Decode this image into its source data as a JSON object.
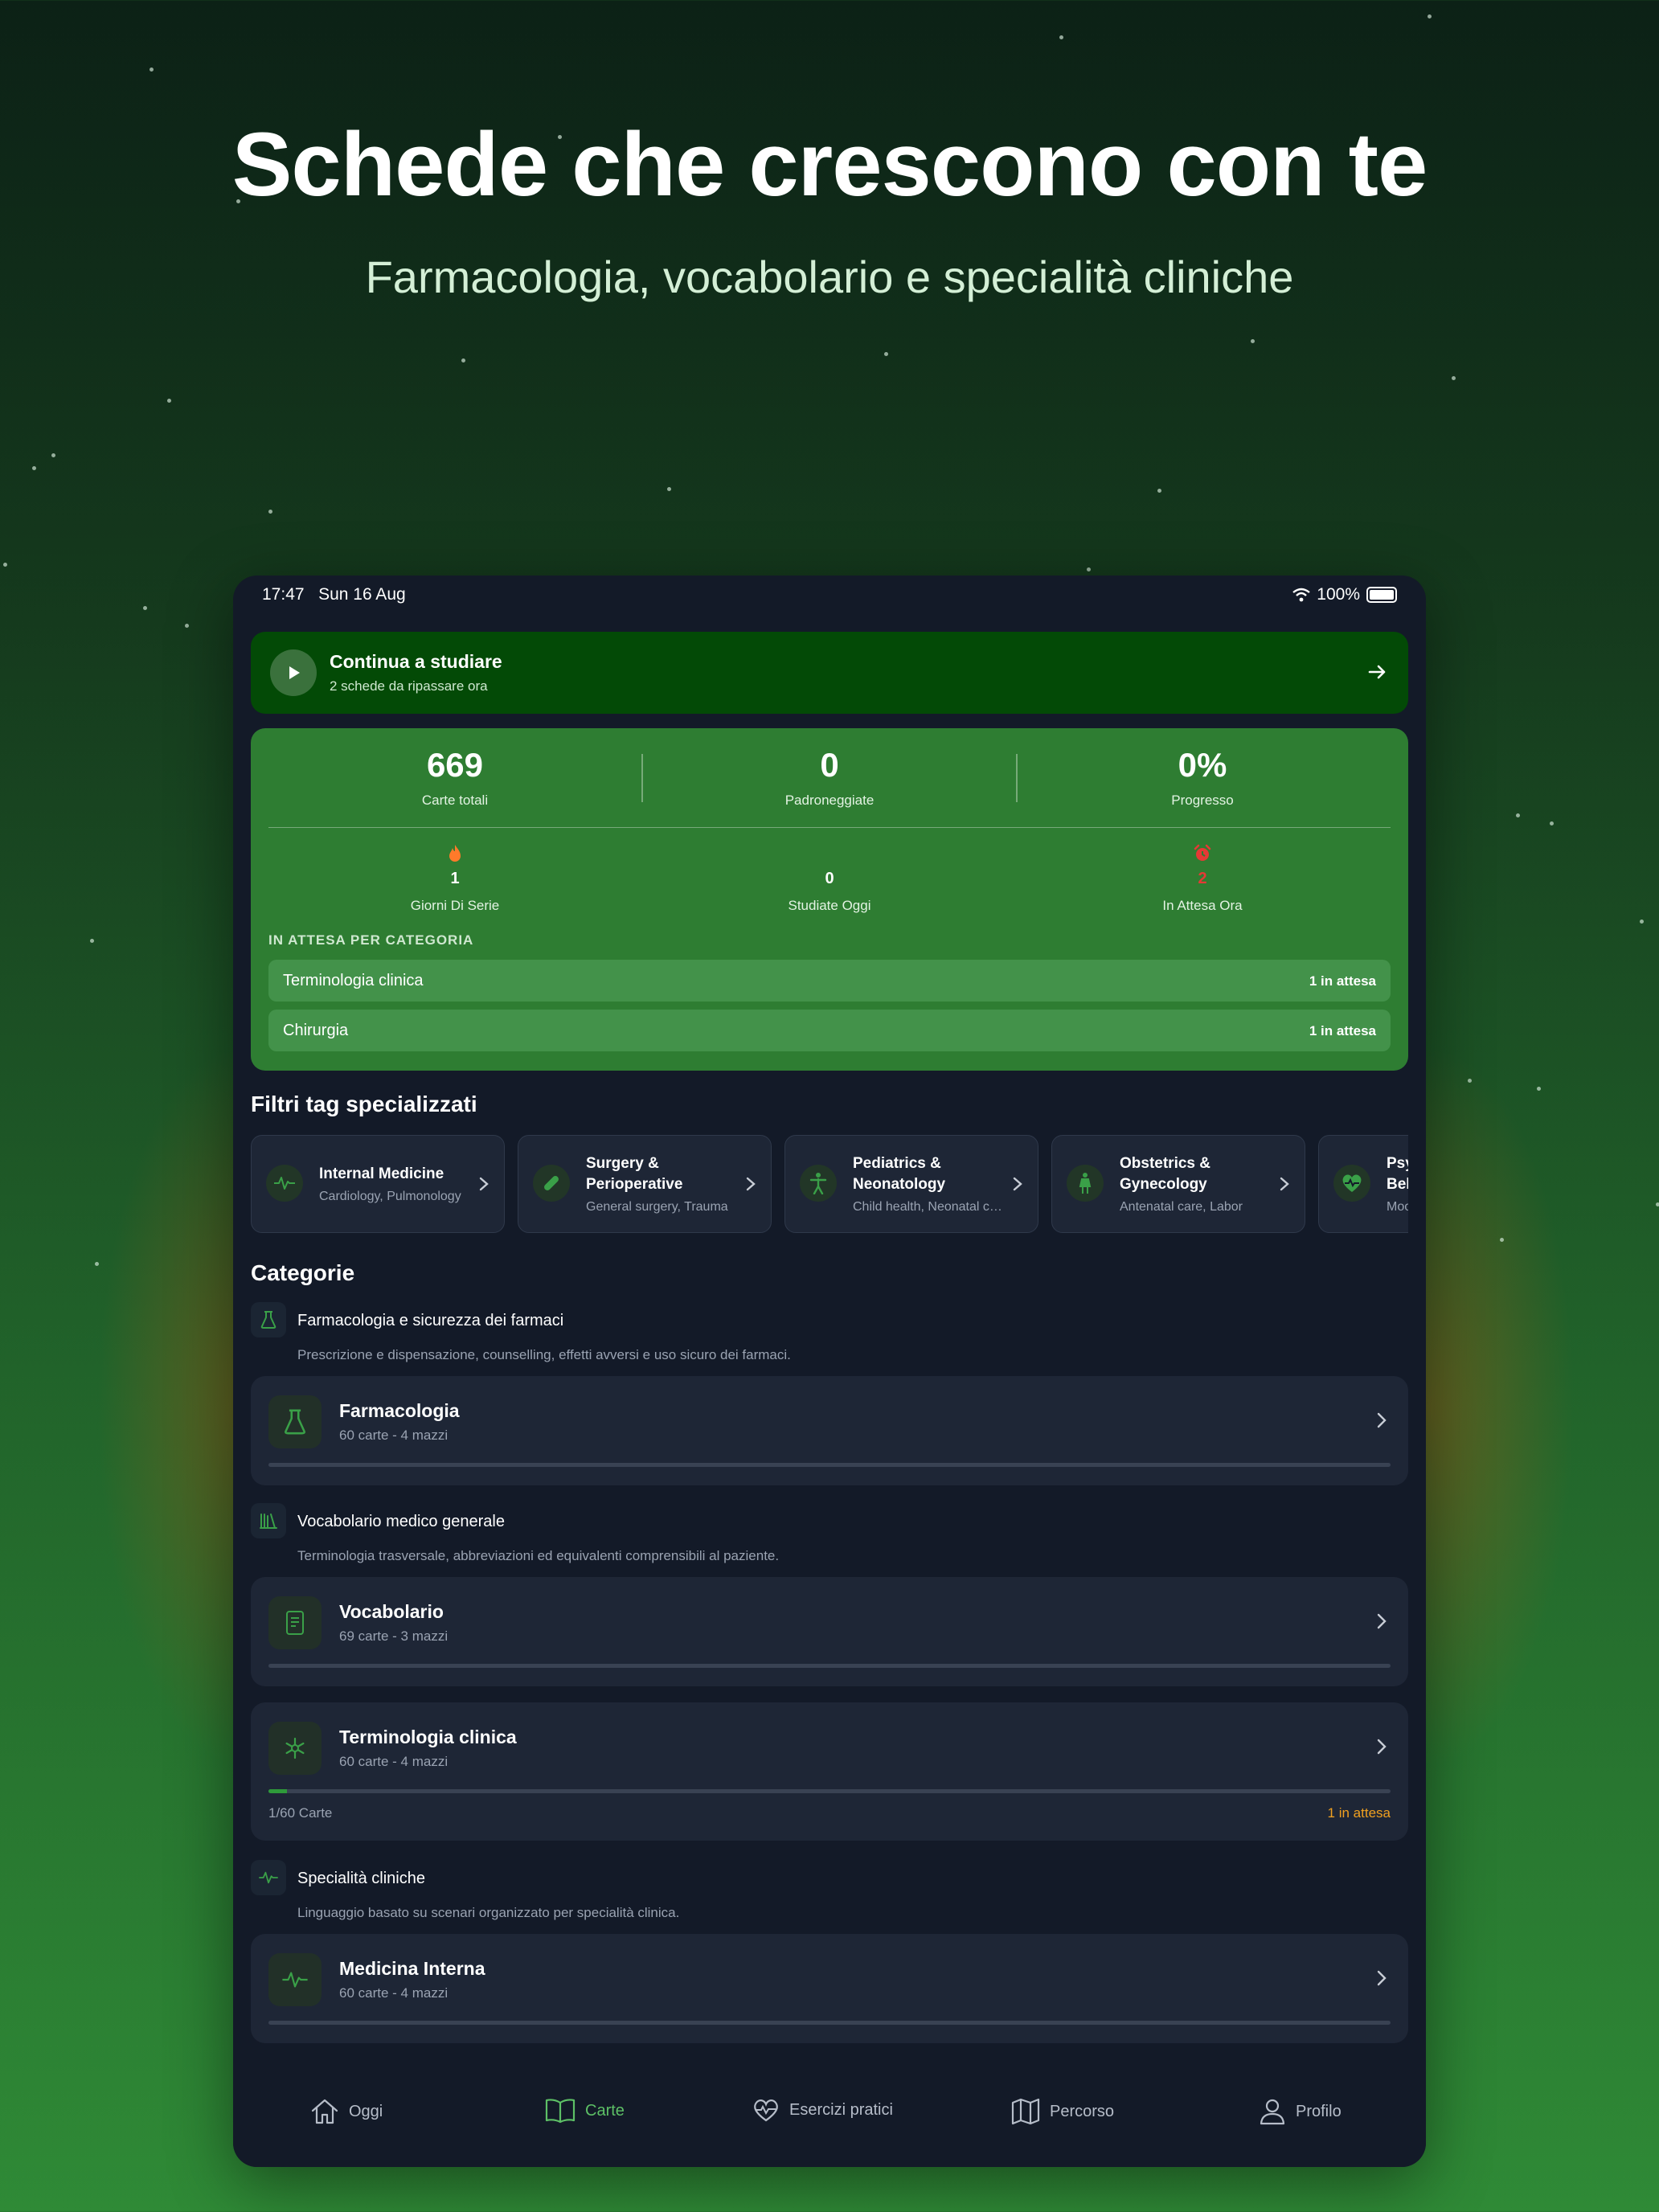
{
  "promo": {
    "headline": "Schede che crescono con te",
    "subline": "Farmacologia, vocabolario e specialità cliniche"
  },
  "status_bar": {
    "time": "17:47",
    "date": "Sun 16 Aug",
    "battery": "100%"
  },
  "continue_card": {
    "title": "Continua a studiare",
    "subtitle": "2 schede da ripassare ora"
  },
  "stats": {
    "top": [
      {
        "value": "669",
        "label": "Carte totali"
      },
      {
        "value": "0",
        "label": "Padroneggiate"
      },
      {
        "value": "0%",
        "label": "Progresso"
      }
    ],
    "bottom": [
      {
        "value": "1",
        "label": "Giorni Di Serie",
        "icon": "flame-icon"
      },
      {
        "value": "0",
        "label": "Studiate Oggi"
      },
      {
        "value": "2",
        "label": "In Attesa Ora",
        "icon": "alarm-icon"
      }
    ],
    "awaiting_title": "IN ATTESA PER CATEGORIA",
    "awaiting": [
      {
        "name": "Terminologia clinica",
        "count": "1 in attesa"
      },
      {
        "name": "Chirurgia",
        "count": "1 in attesa"
      }
    ]
  },
  "tags_section": {
    "title": "Filtri tag specializzati",
    "tags": [
      {
        "name": "Internal Medicine",
        "sub": "Cardiology, Pulmonology",
        "icon": "pulse-icon"
      },
      {
        "name": "Surgery & Perioperative",
        "sub": "General surgery, Trauma",
        "icon": "bandage-icon"
      },
      {
        "name": "Pediatrics & Neonatology",
        "sub": "Child health, Neonatal care",
        "icon": "child-icon"
      },
      {
        "name": "Obstetrics & Gynecology",
        "sub": "Antenatal care, Labor",
        "icon": "pregnant-icon"
      },
      {
        "name": "Psychiatry & Behavioral",
        "sub": "Mood disorders",
        "icon": "heart-pulse-icon"
      }
    ]
  },
  "categories": {
    "title": "Categorie",
    "groups": [
      {
        "title": "Farmacologia e sicurezza dei farmaci",
        "desc": "Prescrizione e dispensazione, counselling, effetti avversi e uso sicuro dei farmaci.",
        "icon": "flask-icon",
        "decks": [
          {
            "title": "Farmacologia",
            "sub": "60 carte - 4 mazzi",
            "icon": "flask-icon",
            "progress": 0
          }
        ]
      },
      {
        "title": "Vocabolario medico generale",
        "desc": "Terminologia trasversale, abbreviazioni ed equivalenti comprensibili al paziente.",
        "icon": "books-icon",
        "decks": [
          {
            "title": "Vocabolario",
            "sub": "69 carte - 3 mazzi",
            "icon": "book-icon",
            "progress": 0
          },
          {
            "title": "Terminologia clinica",
            "sub": "60 carte - 4 mazzi",
            "icon": "medical-star-icon",
            "progress": 0.0167,
            "footer_left": "1/60 Carte",
            "footer_right": "1 in attesa"
          }
        ]
      },
      {
        "title": "Specialità cliniche",
        "desc": "Linguaggio basato su scenari organizzato per specialità clinica.",
        "icon": "pulse-icon",
        "decks": [
          {
            "title": "Medicina Interna",
            "sub": "60 carte - 4 mazzi",
            "icon": "pulse-icon",
            "progress": 0
          }
        ]
      }
    ]
  },
  "tabbar": {
    "tabs": [
      {
        "label": "Oggi",
        "icon": "home-icon",
        "active": false
      },
      {
        "label": "Carte",
        "icon": "open-book-icon",
        "active": true
      },
      {
        "label": "Esercizi pratici",
        "icon": "heart-pulse-icon",
        "active": false
      },
      {
        "label": "Percorso",
        "icon": "map-icon",
        "active": false
      },
      {
        "label": "Profilo",
        "icon": "person-icon",
        "active": false
      }
    ]
  },
  "colors": {
    "accent_green": "#2e7d32",
    "continue_green": "#034a06",
    "pending_orange": "#f0a020",
    "alert_red": "#e53935",
    "active_tab": "#5dc066"
  }
}
